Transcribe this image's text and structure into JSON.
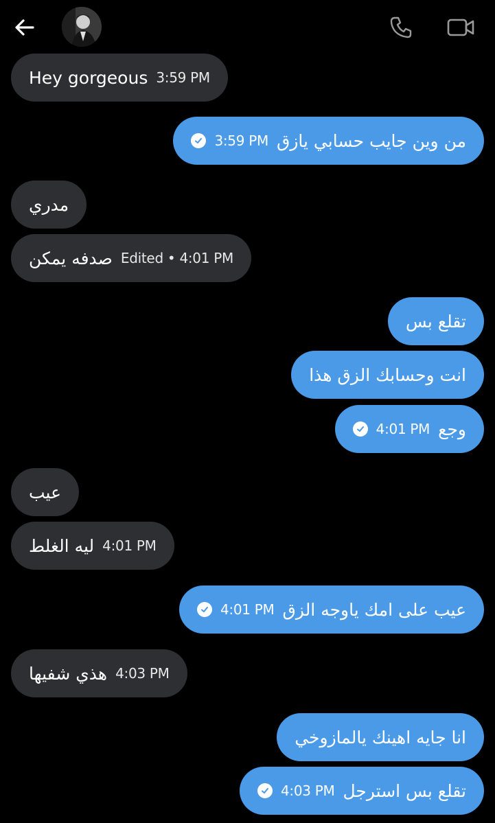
{
  "header": {
    "back_icon": "arrow-left-icon",
    "avatar": "contact-avatar",
    "call_icon": "phone-icon",
    "video_icon": "video-camera-icon"
  },
  "colors": {
    "incoming": "#2e2f33",
    "outgoing": "#4a9ae8",
    "background": "#000000"
  },
  "messages": [
    {
      "dir": "in",
      "text": "Hey gorgeous",
      "time": "3:59 PM"
    },
    {
      "dir": "out",
      "text": "من وين جايب حسابي يازق",
      "time": "3:59 PM",
      "read": true
    },
    {
      "dir": "in",
      "text": "مدري"
    },
    {
      "dir": "in",
      "text": "صدفه يمكن",
      "time": "Edited • 4:01 PM"
    },
    {
      "dir": "out",
      "text": "تقلع بس"
    },
    {
      "dir": "out",
      "text": "انت وحسابك الزق هذا"
    },
    {
      "dir": "out",
      "text": "وجع",
      "time": "4:01 PM",
      "read": true
    },
    {
      "dir": "in",
      "text": "عيب"
    },
    {
      "dir": "in",
      "text": "ليه الغلط",
      "time": "4:01 PM"
    },
    {
      "dir": "out",
      "text": "عيب على امك ياوجه الزق",
      "time": "4:01 PM",
      "read": true
    },
    {
      "dir": "in",
      "text": "هذي شفيها",
      "time": "4:03 PM"
    },
    {
      "dir": "out",
      "text": "انا جايه اهينك يالمازوخي"
    },
    {
      "dir": "out",
      "text": "تقلع بس استرجل",
      "time": "4:03 PM",
      "read": true
    }
  ]
}
